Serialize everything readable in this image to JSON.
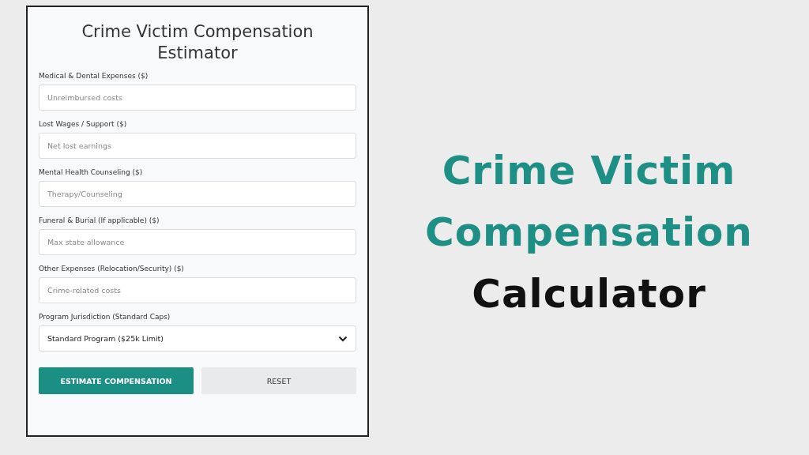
{
  "calculator": {
    "title": "Crime Victim Compensation Estimator",
    "fields": [
      {
        "label": "Medical & Dental Expenses ($)",
        "placeholder": "Unreimbursed costs"
      },
      {
        "label": "Lost Wages / Support ($)",
        "placeholder": "Net lost earnings"
      },
      {
        "label": "Mental Health Counseling ($)",
        "placeholder": "Therapy/Counseling"
      },
      {
        "label": "Funeral & Burial (If applicable) ($)",
        "placeholder": "Max state allowance"
      },
      {
        "label": "Other Expenses (Relocation/Security) ($)",
        "placeholder": "Crime-related costs"
      }
    ],
    "select": {
      "label": "Program Jurisdiction (Standard Caps)",
      "value": "Standard Program ($25k Limit)"
    },
    "buttons": [
      {
        "label": "ESTIMATE COMPENSATION",
        "kind": "primary"
      },
      {
        "label": "RESET",
        "kind": "secondary"
      }
    ]
  },
  "headline": [
    {
      "text": "Crime Victim",
      "kind": "accent"
    },
    {
      "text": "Compensation",
      "kind": "accent"
    },
    {
      "text": "Calculator",
      "kind": "plain"
    }
  ]
}
